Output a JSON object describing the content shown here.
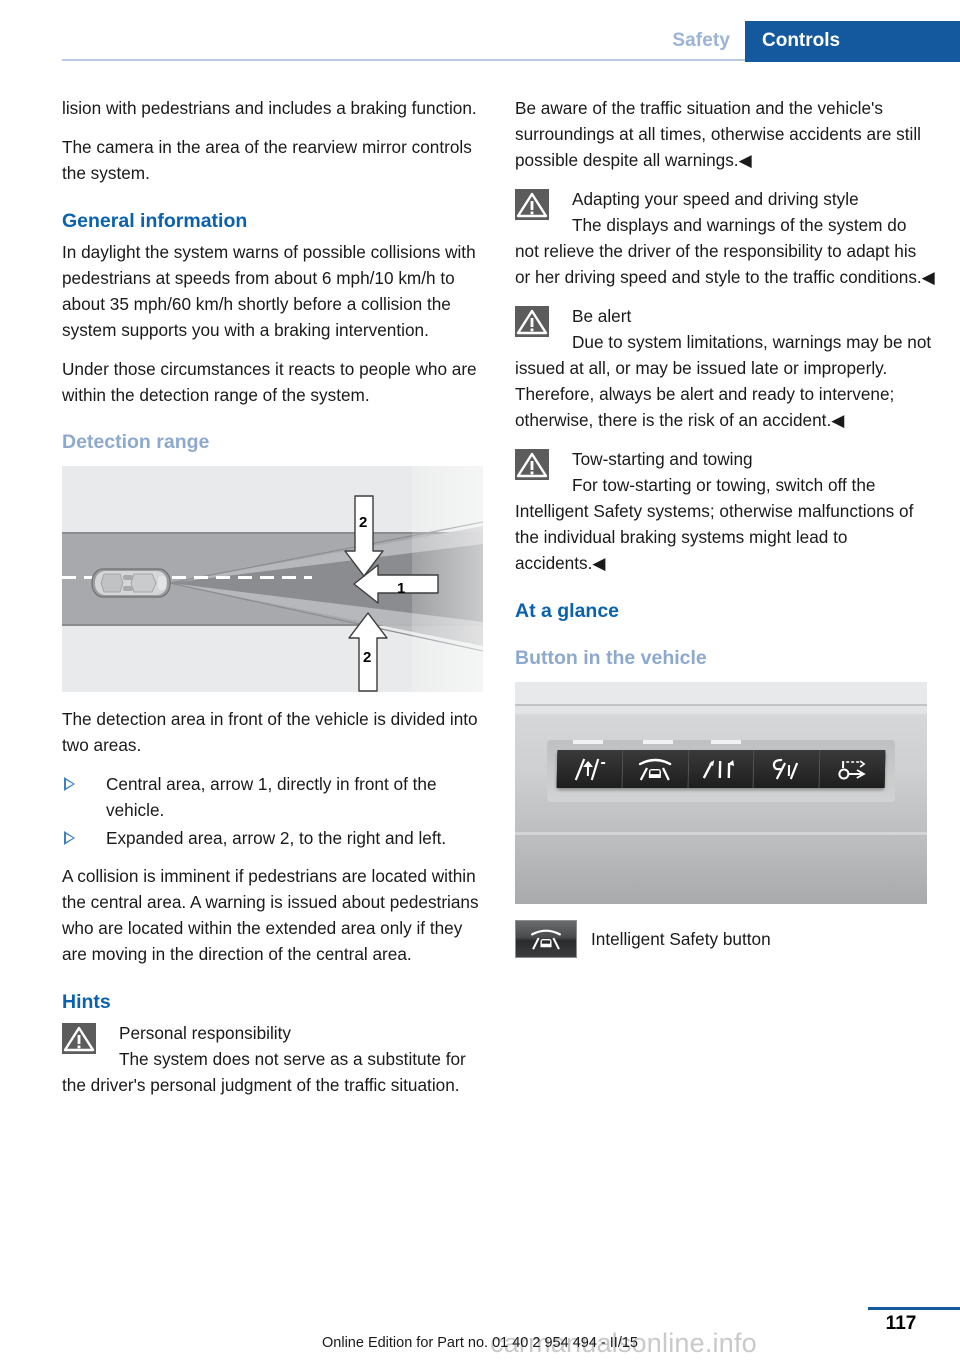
{
  "header": {
    "breadcrumb_inactive": "Safety",
    "breadcrumb_active": "Controls",
    "accent_blue": "#14599e",
    "muted_blue": "#9ab3d6"
  },
  "left_column": {
    "intro_para_1": "lision with pedestrians and includes a braking function.",
    "intro_para_2": "The camera in the area of the rearview mirror controls the system.",
    "heading_general": "General information",
    "general_para_1": "In daylight the system warns of possible collisions with pedestrians at speeds from about 6 mph/10 km/h to about 35 mph/60 km/h shortly before a collision the system supports you with a braking intervention.",
    "general_para_2": "Under those circumstances it reacts to people who are within the detection range of the system.",
    "heading_detection": "Detection range",
    "figure_labels": {
      "arrow_1": "1",
      "arrow_2_top": "2",
      "arrow_2_bottom": "2"
    },
    "detection_para_1": "The detection area in front of the vehicle is divided into two areas.",
    "bullets": [
      "Central area, arrow 1, directly in front of the vehicle.",
      "Expanded area, arrow 2, to the right and left."
    ],
    "detection_para_2": "A collision is imminent if pedestrians are located within the central area. A warning is issued about pedestrians who are located within the extended area only if they are moving in the direction of the central area.",
    "heading_hints": "Hints",
    "warning_personal": {
      "title": "Personal responsibility",
      "body": "The system does not serve as a substitute for the driver's personal judgment of the traffic situation."
    }
  },
  "right_column": {
    "continuation_para": "Be aware of the traffic situation and the vehicle's surroundings at all times, otherwise accidents are still possible despite all warnings.◀",
    "warning_adapting": {
      "title": "Adapting your speed and driving style",
      "body": "The displays and warnings of the system do not relieve the driver of the responsibility to adapt his or her driving speed and style to the traffic conditions.◀"
    },
    "warning_alert": {
      "title": "Be alert",
      "body": "Due to system limitations, warnings may be not issued at all, or may be issued late or improperly. Therefore, always be alert and ready to intervene; otherwise, there is the risk of an accident.◀"
    },
    "warning_tow": {
      "title": "Tow-starting and towing",
      "body": "For tow-starting or towing, switch off the Intelligent Safety systems; otherwise malfunctions of the individual braking systems might lead to accidents.◀"
    },
    "heading_at_a_glance": "At a glance",
    "heading_button": "Button in the vehicle",
    "panel_buttons": [
      "lane-departure-warning-icon",
      "intelligent-safety-icon",
      "lane-change-warning-icon",
      "active-blind-spot-icon",
      "night-vision-icon"
    ],
    "caption": "Intelligent Safety button",
    "caption_icon": "intelligent-safety-button-icon"
  },
  "footer": {
    "page_number": "117",
    "edition_text": "Online Edition for Part no. 01 40 2 954 494 - II/15",
    "watermark": "carmanualsonline.info"
  }
}
